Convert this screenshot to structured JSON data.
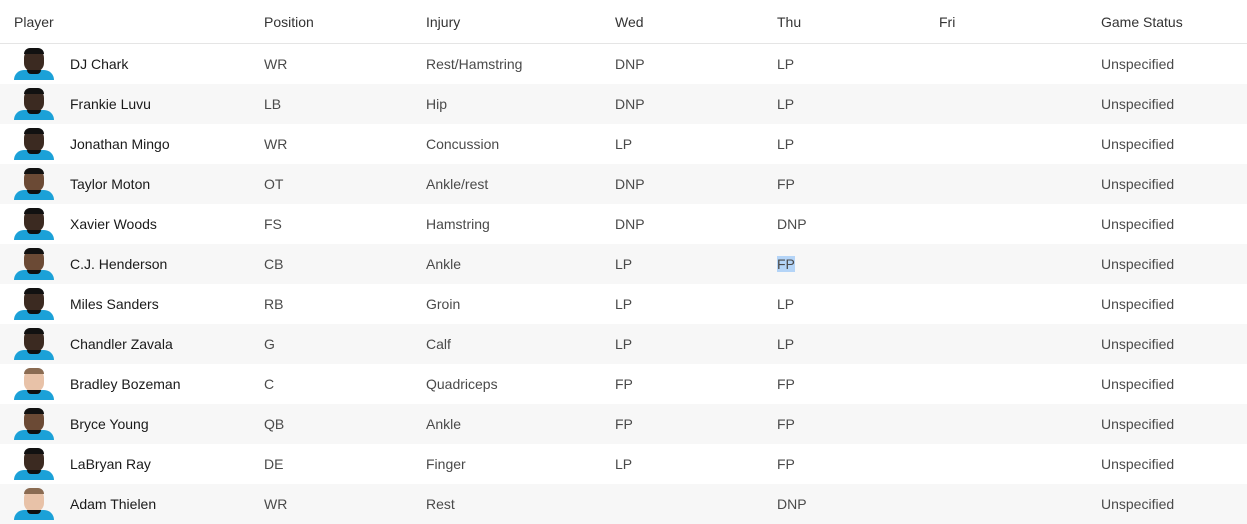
{
  "table": {
    "headers": {
      "player": "Player",
      "position": "Position",
      "injury": "Injury",
      "wed": "Wed",
      "thu": "Thu",
      "fri": "Fri",
      "status": "Game Status"
    },
    "rows": [
      {
        "name": "DJ Chark",
        "position": "WR",
        "injury": "Rest/Hamstring",
        "wed": "DNP",
        "thu": "LP",
        "fri": "",
        "status": "Unspecified"
      },
      {
        "name": "Frankie Luvu",
        "position": "LB",
        "injury": "Hip",
        "wed": "DNP",
        "thu": "LP",
        "fri": "",
        "status": "Unspecified"
      },
      {
        "name": "Jonathan Mingo",
        "position": "WR",
        "injury": "Concussion",
        "wed": "LP",
        "thu": "LP",
        "fri": "",
        "status": "Unspecified"
      },
      {
        "name": "Taylor Moton",
        "position": "OT",
        "injury": "Ankle/rest",
        "wed": "DNP",
        "thu": "FP",
        "fri": "",
        "status": "Unspecified"
      },
      {
        "name": "Xavier Woods",
        "position": "FS",
        "injury": "Hamstring",
        "wed": "DNP",
        "thu": "DNP",
        "fri": "",
        "status": "Unspecified"
      },
      {
        "name": "C.J. Henderson",
        "position": "CB",
        "injury": "Ankle",
        "wed": "LP",
        "thu": "FP",
        "fri": "",
        "status": "Unspecified"
      },
      {
        "name": "Miles Sanders",
        "position": "RB",
        "injury": "Groin",
        "wed": "LP",
        "thu": "LP",
        "fri": "",
        "status": "Unspecified"
      },
      {
        "name": "Chandler Zavala",
        "position": "G",
        "injury": "Calf",
        "wed": "LP",
        "thu": "LP",
        "fri": "",
        "status": "Unspecified"
      },
      {
        "name": "Bradley Bozeman",
        "position": "C",
        "injury": "Quadriceps",
        "wed": "FP",
        "thu": "FP",
        "fri": "",
        "status": "Unspecified"
      },
      {
        "name": "Bryce Young",
        "position": "QB",
        "injury": "Ankle",
        "wed": "FP",
        "thu": "FP",
        "fri": "",
        "status": "Unspecified"
      },
      {
        "name": "LaBryan Ray",
        "position": "DE",
        "injury": "Finger",
        "wed": "LP",
        "thu": "FP",
        "fri": "",
        "status": "Unspecified"
      },
      {
        "name": "Adam Thielen",
        "position": "WR",
        "injury": "Rest",
        "wed": "",
        "thu": "DNP",
        "fri": "",
        "status": "Unspecified"
      }
    ]
  },
  "colors": {
    "jersey": "#1ba1d8",
    "stripe": "#f7f7f7",
    "selection": "#b4d4f7"
  }
}
